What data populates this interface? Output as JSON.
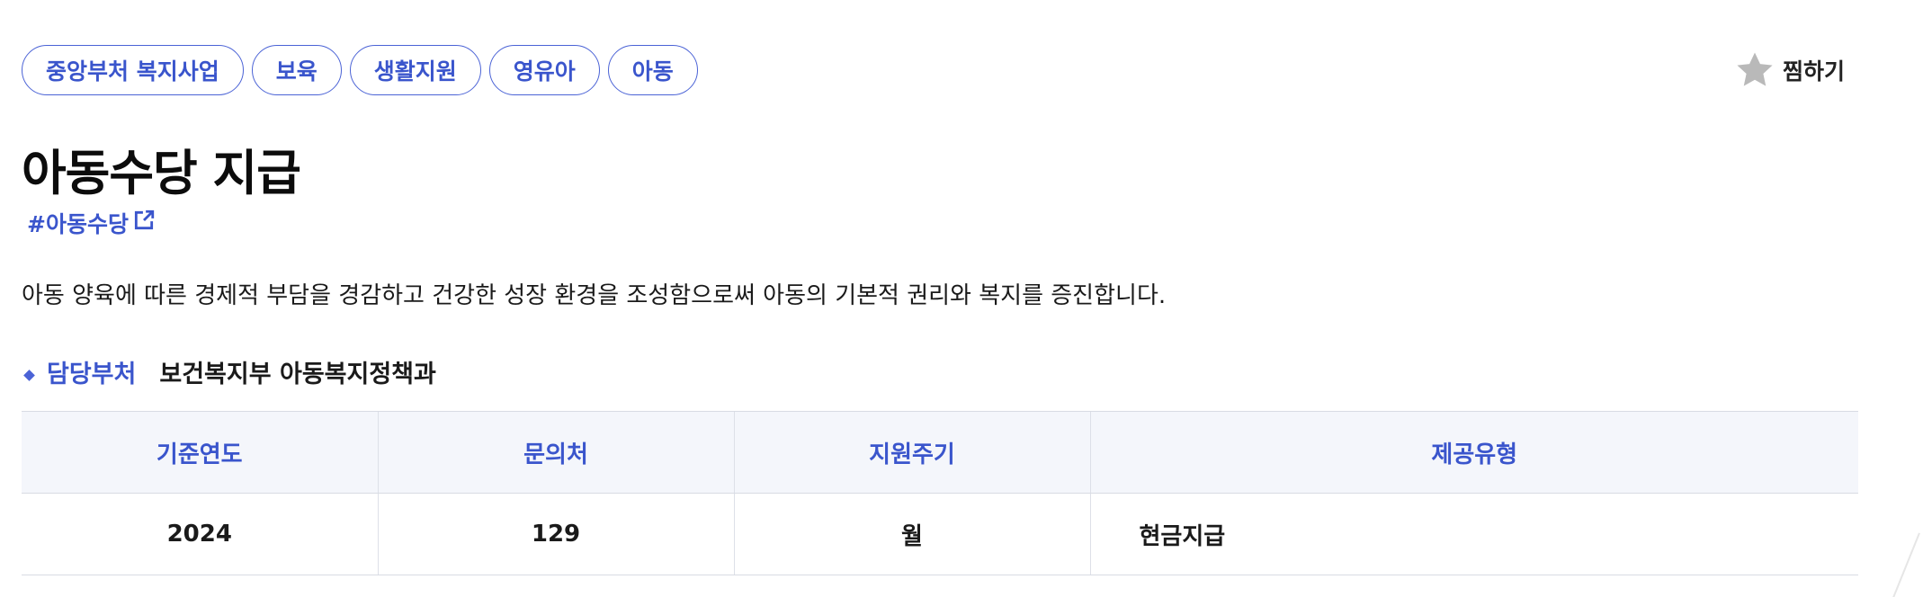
{
  "tags": [
    "중앙부처 복지사업",
    "보육",
    "생활지원",
    "영유아",
    "아동"
  ],
  "favorite": {
    "label": "찜하기",
    "icon": "star-icon",
    "icon_color": "#b9b9b9"
  },
  "title": "아동수당 지급",
  "hashtag": {
    "text": "#아동수당",
    "icon": "external-link-icon"
  },
  "description": "아동 양육에 따른 경제적 부담을 경감하고 건강한 성장 환경을 조성함으로써 아동의 기본적 권리와 복지를 증진합니다.",
  "department": {
    "label": "담당부처",
    "value": "보건복지부 아동복지정책과"
  },
  "table": {
    "headers": [
      "기준연도",
      "문의처",
      "지원주기",
      "제공유형"
    ],
    "row": [
      "2024",
      "129",
      "월",
      "현금지급"
    ]
  },
  "colors": {
    "accent": "#3a55cc",
    "header_bg": "#f4f6fb",
    "border": "#d8dbe3"
  }
}
